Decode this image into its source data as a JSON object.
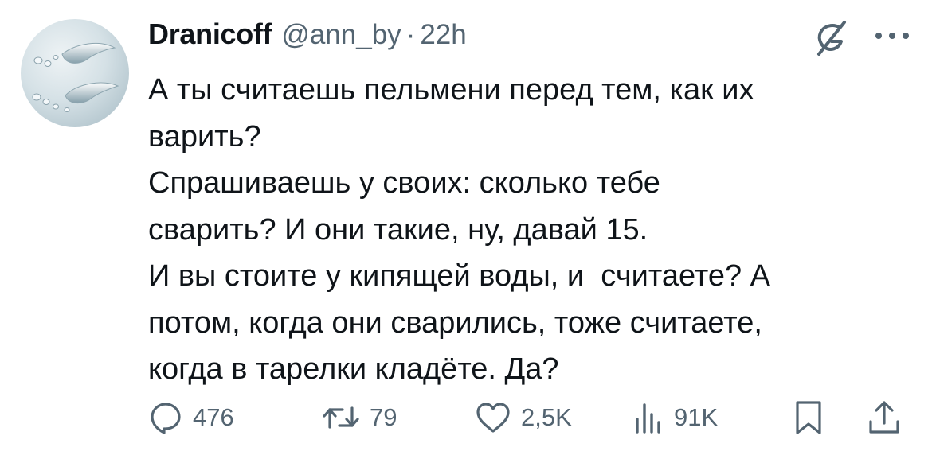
{
  "tweet": {
    "author": {
      "display_name": "Dranicoff",
      "handle": "@ann_by",
      "separator": "·",
      "time": "22h",
      "avatar_icon": "water-droplets-avatar"
    },
    "header_icons": {
      "grok": "grok-icon",
      "more": "more-icon"
    },
    "text_lines": [
      "А ты считаешь пельмени перед тем, как их",
      "варить?",
      "Спрашиваешь у своих: сколько тебе",
      "сварить? И они такие, ну, давай 15.",
      "И вы стоите у кипящей воды, и  считаете? А",
      "потом, когда они сварились, тоже считаете,",
      "когда в тарелки кладёте. Да?"
    ],
    "actions": {
      "replies": {
        "icon": "reply-icon",
        "count": "476"
      },
      "reposts": {
        "icon": "repost-icon",
        "count": "79"
      },
      "likes": {
        "icon": "like-icon",
        "count": "2,5K"
      },
      "views": {
        "icon": "views-icon",
        "count": "91K"
      },
      "bookmark": {
        "icon": "bookmark-icon"
      },
      "share": {
        "icon": "share-icon"
      }
    },
    "colors": {
      "text": "#0f1419",
      "secondary": "#536471"
    }
  }
}
